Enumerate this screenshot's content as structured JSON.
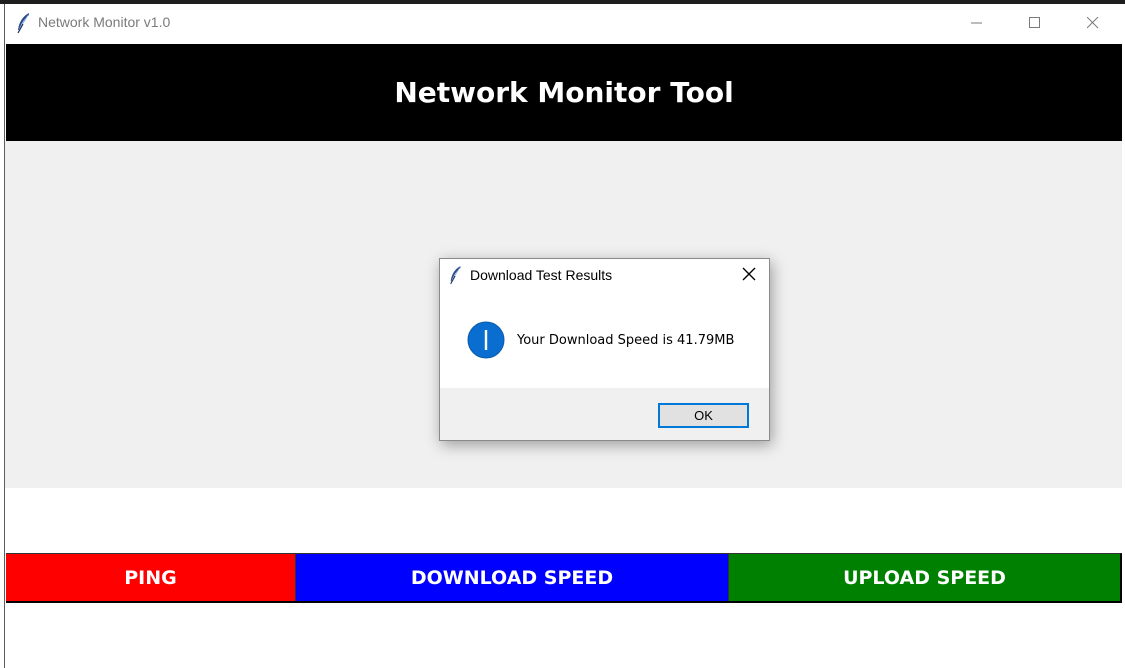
{
  "window": {
    "title": "Network Monitor v1.0",
    "controls": {
      "minimize": "minimize-icon",
      "maximize": "maximize-icon",
      "close": "close-icon"
    }
  },
  "header": {
    "title": "Network Monitor Tool",
    "background": "#000000",
    "text_color": "#ffffff"
  },
  "buttons": [
    {
      "label": "PING",
      "color": "#ff0000"
    },
    {
      "label": "DOWNLOAD SPEED",
      "color": "#0000ff"
    },
    {
      "label": "UPLOAD SPEED",
      "color": "#008000"
    }
  ],
  "dialog": {
    "title": "Download Test Results",
    "icon": "info-icon",
    "message": "Your Download Speed is 41.79MB",
    "ok_label": "OK",
    "accent": "#0078d7"
  }
}
